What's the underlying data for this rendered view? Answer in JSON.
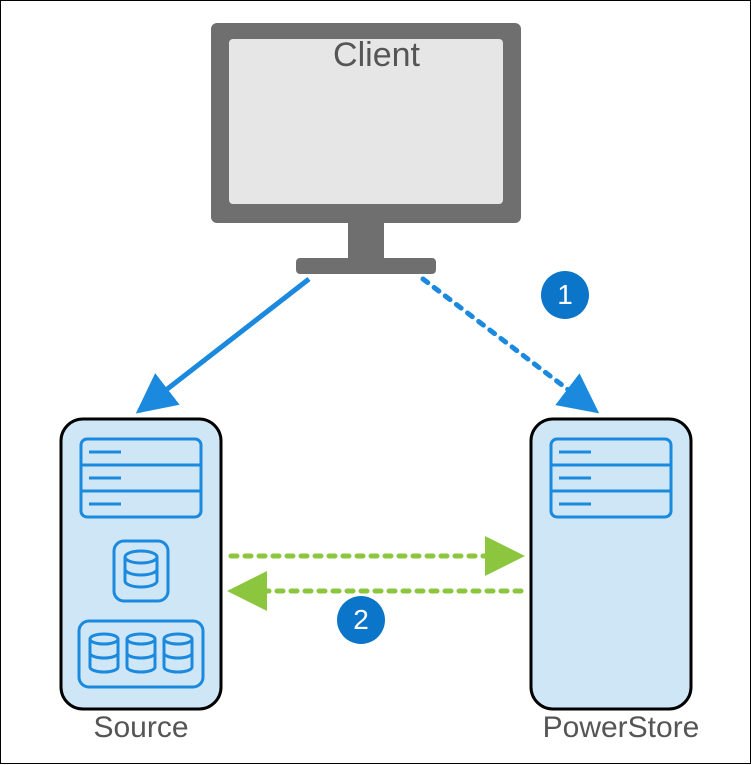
{
  "labels": {
    "client": "Client",
    "source": "Source",
    "powerstore": "PowerStore"
  },
  "steps": {
    "one": "1",
    "two": "2"
  },
  "colors": {
    "accent_blue": "#0b76c9",
    "light_blue_fill": "#cfe6f6",
    "line_blue": "#1b8ade",
    "line_green": "#8cc63f",
    "monitor_gray": "#6f6f6f",
    "monitor_screen": "#e6e6e6",
    "text_gray": "#555555"
  },
  "diagram": {
    "nodes": [
      {
        "id": "client",
        "role": "client-monitor"
      },
      {
        "id": "source",
        "role": "storage-appliance",
        "has_internal_db_icons": true
      },
      {
        "id": "powerstore",
        "role": "storage-appliance",
        "has_internal_db_icons": false
      }
    ],
    "edges": [
      {
        "from": "client",
        "to": "source",
        "style": "solid",
        "color": "blue",
        "arrow": "to"
      },
      {
        "from": "client",
        "to": "powerstore",
        "style": "dotted",
        "color": "blue",
        "arrow": "to",
        "badge": "1"
      },
      {
        "from": "source",
        "to": "powerstore",
        "style": "dotted",
        "color": "green",
        "arrow": "both",
        "badge": "2"
      }
    ]
  }
}
